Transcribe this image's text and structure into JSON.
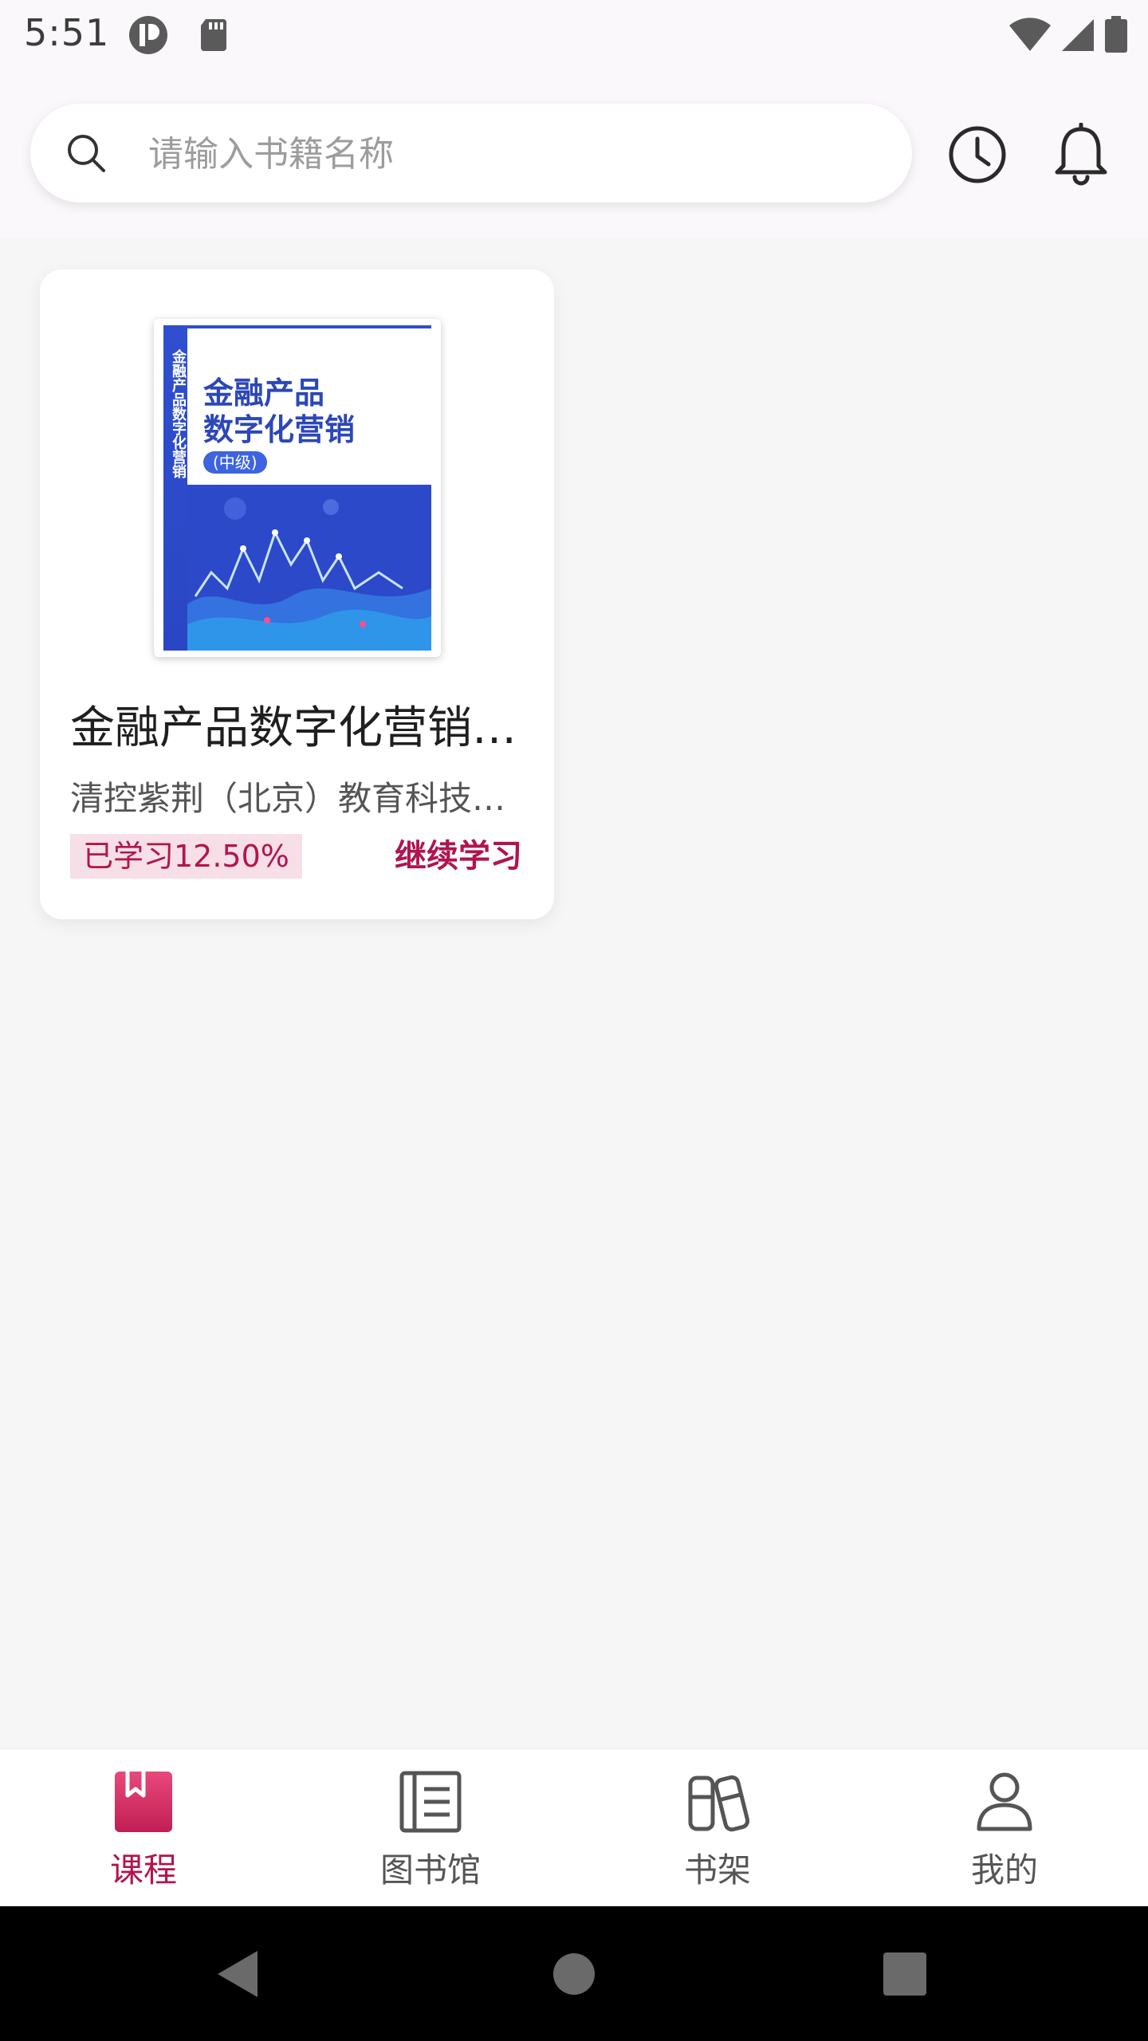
{
  "status_bar": {
    "time": "5:51",
    "icons": [
      "app-notification-icon",
      "sd-card-icon",
      "wifi-icon",
      "signal-icon",
      "battery-icon"
    ]
  },
  "header": {
    "search": {
      "placeholder": "请输入书籍名称",
      "value": ""
    },
    "icons": [
      "history-clock-icon",
      "notification-bell-icon"
    ]
  },
  "courses": [
    {
      "title": "金融产品数字化营销（中级）",
      "author": "清控紫荆（北京）教育科技股份有限公司",
      "progress_label": "已学习12.50%",
      "progress_value": 12.5,
      "action_label": "继续学习",
      "cover": {
        "title_line1": "金融产品",
        "title_line2": "数字化营销",
        "level": "(中级)",
        "spine": "金融产品数字化营销"
      }
    }
  ],
  "bottom_nav": {
    "items": [
      {
        "label": "课程",
        "icon": "bookmark-book-icon",
        "active": true
      },
      {
        "label": "图书馆",
        "icon": "library-list-icon",
        "active": false
      },
      {
        "label": "书架",
        "icon": "bookshelf-icon",
        "active": false
      },
      {
        "label": "我的",
        "icon": "user-profile-icon",
        "active": false
      }
    ]
  },
  "colors": {
    "accent": "#b0154f",
    "progress_bg": "#f6dfe6",
    "page_bg": "#f7f6f7"
  }
}
